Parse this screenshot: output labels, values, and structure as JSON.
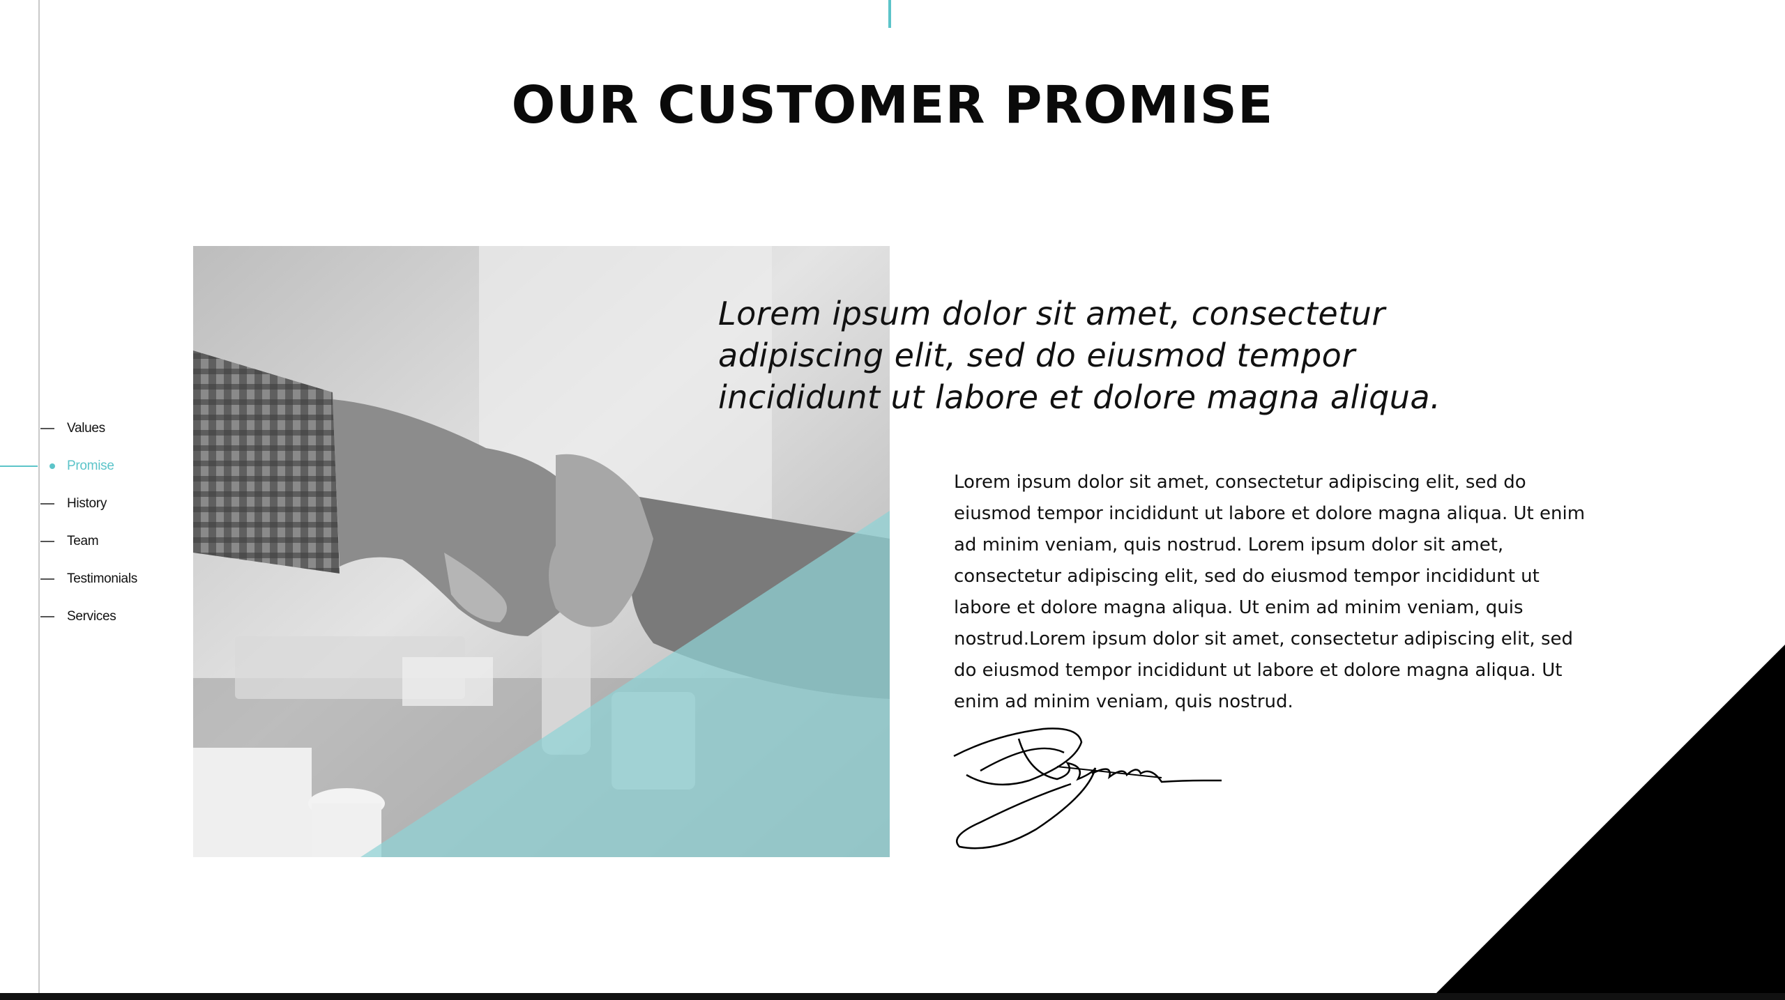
{
  "header": {
    "title": "OUR CUSTOMER PROMISE"
  },
  "nav": {
    "items": [
      {
        "label": "Values",
        "active": false
      },
      {
        "label": "Promise",
        "active": true
      },
      {
        "label": "History",
        "active": false
      },
      {
        "label": "Team",
        "active": false
      },
      {
        "label": "Testimonials",
        "active": false
      },
      {
        "label": "Services",
        "active": false
      }
    ]
  },
  "main": {
    "quote": "Lorem ipsum dolor sit amet, consectetur adipiscing elit, sed do eiusmod tempor incididunt ut labore et dolore magna aliqua.",
    "body": "Lorem ipsum dolor sit amet, consectetur adipiscing elit, sed do eiusmod tempor incididunt ut labore et dolore magna aliqua. Ut enim ad minim veniam, quis nostrud. Lorem ipsum dolor sit amet, consectetur adipiscing elit, sed do eiusmod tempor incididunt ut labore et dolore magna aliqua. Ut enim ad minim veniam, quis nostrud.Lorem ipsum dolor sit amet, consectetur adipiscing elit, sed do eiusmod tempor incididunt ut labore et dolore magna aliqua. Ut enim ad minim veniam, quis nostrud.",
    "image_subject": "handshake-photo",
    "signature": "signature"
  },
  "colors": {
    "accent": "#5cc4c9",
    "overlay": "#8fd3d6",
    "corner": "#000000"
  }
}
